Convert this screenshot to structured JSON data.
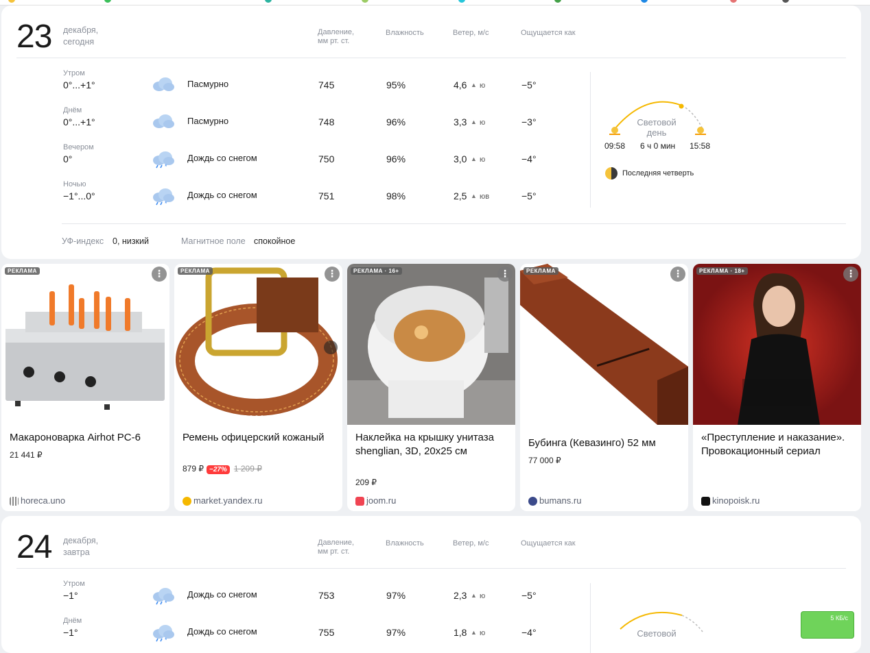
{
  "today": {
    "day": "23",
    "date_line1": "декабря,",
    "date_line2": "сегодня",
    "headers": {
      "pressure_1": "Давление,",
      "pressure_2": "мм рт. ст.",
      "humidity": "Влажность",
      "wind": "Ветер, м/с",
      "feels": "Ощущается как"
    },
    "rows": [
      {
        "period": "Утром",
        "temp": "0°...+1°",
        "icon": "cloudy-icon",
        "cond": "Пасмурно",
        "press": "745",
        "hum": "95%",
        "wind": "4,6",
        "dir": "ю",
        "feel": "−5°"
      },
      {
        "period": "Днём",
        "temp": "0°...+1°",
        "icon": "cloudy-icon",
        "cond": "Пасмурно",
        "press": "748",
        "hum": "96%",
        "wind": "3,3",
        "dir": "ю",
        "feel": "−3°"
      },
      {
        "period": "Вечером",
        "temp": "0°",
        "icon": "rain-snow-icon",
        "cond": "Дождь со снегом",
        "press": "750",
        "hum": "96%",
        "wind": "3,0",
        "dir": "ю",
        "feel": "−4°"
      },
      {
        "period": "Ночью",
        "temp": "−1°...0°",
        "icon": "rain-snow-icon",
        "cond": "Дождь со снегом",
        "press": "751",
        "hum": "98%",
        "wind": "2,5",
        "dir": "юв",
        "feel": "−5°"
      }
    ],
    "daylight": {
      "label_1": "Световой",
      "label_2": "день",
      "sunrise": "09:58",
      "duration": "6 ч 0 мин",
      "sunset": "15:58",
      "moon": "Последняя четверть"
    },
    "uv_label": "УФ-индекс",
    "uv_value": "0, низкий",
    "mag_label": "Магнитное поле",
    "mag_value": "спокойное"
  },
  "ads": [
    {
      "tag": "РЕКЛАМА",
      "title": "Макароноварка Airhot PC-6",
      "price": "21 441 ₽",
      "source": "horeca.uno"
    },
    {
      "tag": "РЕКЛАМА",
      "title": "Ремень офицерский кожаный",
      "price": "879 ₽",
      "discount": "−27%",
      "old_price": "1 209 ₽",
      "source": "market.yandex.ru"
    },
    {
      "tag": "РЕКЛАМА · 16+",
      "title": "Наклейка на крышку унитаза shenglian, 3D, 20x25 см",
      "price": "209 ₽",
      "source": "joom.ru"
    },
    {
      "tag": "РЕКЛАМА",
      "title": "Бубинга (Кевазинго) 52 мм",
      "price": "77 000 ₽",
      "source": "bumans.ru"
    },
    {
      "tag": "РЕКЛАМА · 18+",
      "title": "«Преступление и наказание». Провокационный сериал",
      "price": "",
      "source": "kinopoisk.ru"
    }
  ],
  "tomorrow": {
    "day": "24",
    "date_line1": "декабря,",
    "date_line2": "завтра",
    "rows": [
      {
        "period": "Утром",
        "temp": "−1°",
        "icon": "rain-snow-icon",
        "cond": "Дождь со снегом",
        "press": "753",
        "hum": "97%",
        "wind": "2,3",
        "dir": "ю",
        "feel": "−5°"
      },
      {
        "period": "Днём",
        "temp": "−1°",
        "icon": "rain-snow-icon",
        "cond": "Дождь со снегом",
        "press": "755",
        "hum": "97%",
        "wind": "1,8",
        "dir": "ю",
        "feel": "−4°"
      }
    ],
    "daylight_label": "Световой"
  },
  "widget": {
    "speed": "5 КБ/с"
  }
}
